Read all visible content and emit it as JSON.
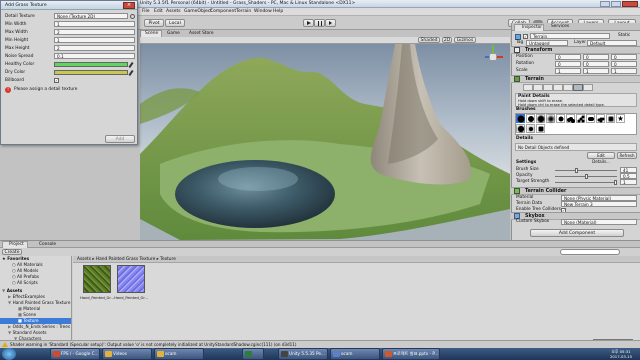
{
  "window": {
    "title": "Unity 5.3.5f1 Personal (64bit) - Untitled - Grass_Shaders - PC, Mac & Linux Standalone <DX11>"
  },
  "menu": [
    "File",
    "Edit",
    "Assets",
    "GameObject",
    "Component",
    "Terrain",
    "Window",
    "Help"
  ],
  "toolbar": {
    "pivot": "Pivot",
    "space": "Local",
    "collab": "Collab",
    "account": "Account",
    "layers": "Layers",
    "layout": "Layout"
  },
  "scene_tabs": [
    "Scene",
    "Game",
    "Asset Store"
  ],
  "scene_bar": {
    "shading": "Shaded",
    "mode": "2D",
    "gizmos": "Gizmos"
  },
  "dialog": {
    "title": "Add Grass Texture",
    "rows": [
      {
        "label": "Detail Texture",
        "value": "None (Texture 2D)"
      },
      {
        "label": "Min Width",
        "value": "1"
      },
      {
        "label": "Max Width",
        "value": "2"
      },
      {
        "label": "Min Height",
        "value": "1"
      },
      {
        "label": "Max Height",
        "value": "2"
      },
      {
        "label": "Noise Spread",
        "value": "0.1"
      },
      {
        "label": "Healthy Color",
        "value": ""
      },
      {
        "label": "Dry Color",
        "value": ""
      },
      {
        "label": "Billboard",
        "value": ""
      }
    ],
    "healthy_color": "#5fd55f",
    "dry_color": "#c8c850",
    "error": "Please assign a detail texture",
    "add_button": "Add"
  },
  "inspector": {
    "tabs": [
      "Inspector",
      "Services"
    ],
    "object_name": "Terrain",
    "static_label": "Static",
    "tag_label": "Tag",
    "tag_value": "Untagged",
    "layer_label": "Layer",
    "layer_value": "Default",
    "transform": {
      "title": "Transform",
      "rows": [
        {
          "label": "Position",
          "x": "0",
          "y": "0",
          "z": "0"
        },
        {
          "label": "Rotation",
          "x": "0",
          "y": "0",
          "z": "0"
        },
        {
          "label": "Scale",
          "x": "1",
          "y": "1",
          "z": "1"
        }
      ]
    },
    "terrain": {
      "title": "Terrain",
      "section": "Paint Details",
      "help1": "Hold down shift to erase.",
      "help2": "Hold down ctrl to erase the selected detail type.",
      "brushes_label": "Brushes",
      "details_label": "Details",
      "no_detail": "No Detail Objects defined",
      "edit_details": "Edit Details...",
      "refresh": "Refresh",
      "settings_label": "Settings",
      "settings": [
        {
          "label": "Brush Size",
          "value": "41"
        },
        {
          "label": "Opacity",
          "value": "0.5"
        },
        {
          "label": "Target Strength",
          "value": "1"
        }
      ]
    },
    "collider": {
      "title": "Terrain Collider",
      "rows": [
        {
          "label": "Material",
          "value": "None (Physic Material)"
        },
        {
          "label": "Terrain Data",
          "value": "New Terrain 3"
        },
        {
          "label": "Enable Tree Colliders",
          "value": ""
        }
      ]
    },
    "skybox": {
      "title": "Skybox",
      "rows": [
        {
          "label": "Custom Skybox",
          "value": "None (Material)"
        }
      ]
    },
    "add_component": "Add Component"
  },
  "project": {
    "tabs": [
      "Project",
      "Console"
    ],
    "create": "Create",
    "tree": [
      {
        "label": "Favorites",
        "indent": 0,
        "bold": true
      },
      {
        "label": "All Materials",
        "indent": 1
      },
      {
        "label": "All Models",
        "indent": 1
      },
      {
        "label": "All Prefabs",
        "indent": 1
      },
      {
        "label": "All Scripts",
        "indent": 1
      },
      {
        "label": "Assets",
        "indent": 0,
        "bold": true
      },
      {
        "label": "EffectExamples",
        "indent": 1
      },
      {
        "label": "Hand Painted Grass Texture",
        "indent": 1
      },
      {
        "label": "Material",
        "indent": 2
      },
      {
        "label": "Scene",
        "indent": 2
      },
      {
        "label": "Texture",
        "indent": 2,
        "selected": true
      },
      {
        "label": "Odds_N_Ends Series : Trees",
        "indent": 1
      },
      {
        "label": "Standard Assets",
        "indent": 1
      },
      {
        "label": "Characters",
        "indent": 2
      },
      {
        "label": "FirstPersonCharacter",
        "indent": 3
      }
    ],
    "breadcrumb": "Assets ▸ Hand Painted Grass Texture ▸ Texture",
    "assets": [
      {
        "name": "Hand_Painted_Gr...",
        "kind": "grass"
      },
      {
        "name": "Hand_Painted_Gr...",
        "kind": "normal"
      }
    ]
  },
  "status": {
    "message": "Shader warning in 'Standard (Specular setup)': Output value 'o' is not completely initialized at UnityStandardShadow.cginc(111) (on d3d11)"
  },
  "taskbar": {
    "items": [
      {
        "label": "FPS / - Google C...",
        "color": "#d04a2c"
      },
      {
        "label": "Videos",
        "color": "#e2b23c"
      },
      {
        "label": "ocam",
        "color": "#e2b23c"
      },
      {
        "label": "",
        "color": "#2e7d3a"
      },
      {
        "label": "Unity 5.5.35 Pe...",
        "color": "#444444"
      },
      {
        "label": "ocam",
        "color": "#5c7fc7"
      },
      {
        "label": "프로젝트 발표.pptx - P...",
        "color": "#d0582c"
      }
    ],
    "time": "오후 05:31",
    "date": "2017-03-15"
  }
}
